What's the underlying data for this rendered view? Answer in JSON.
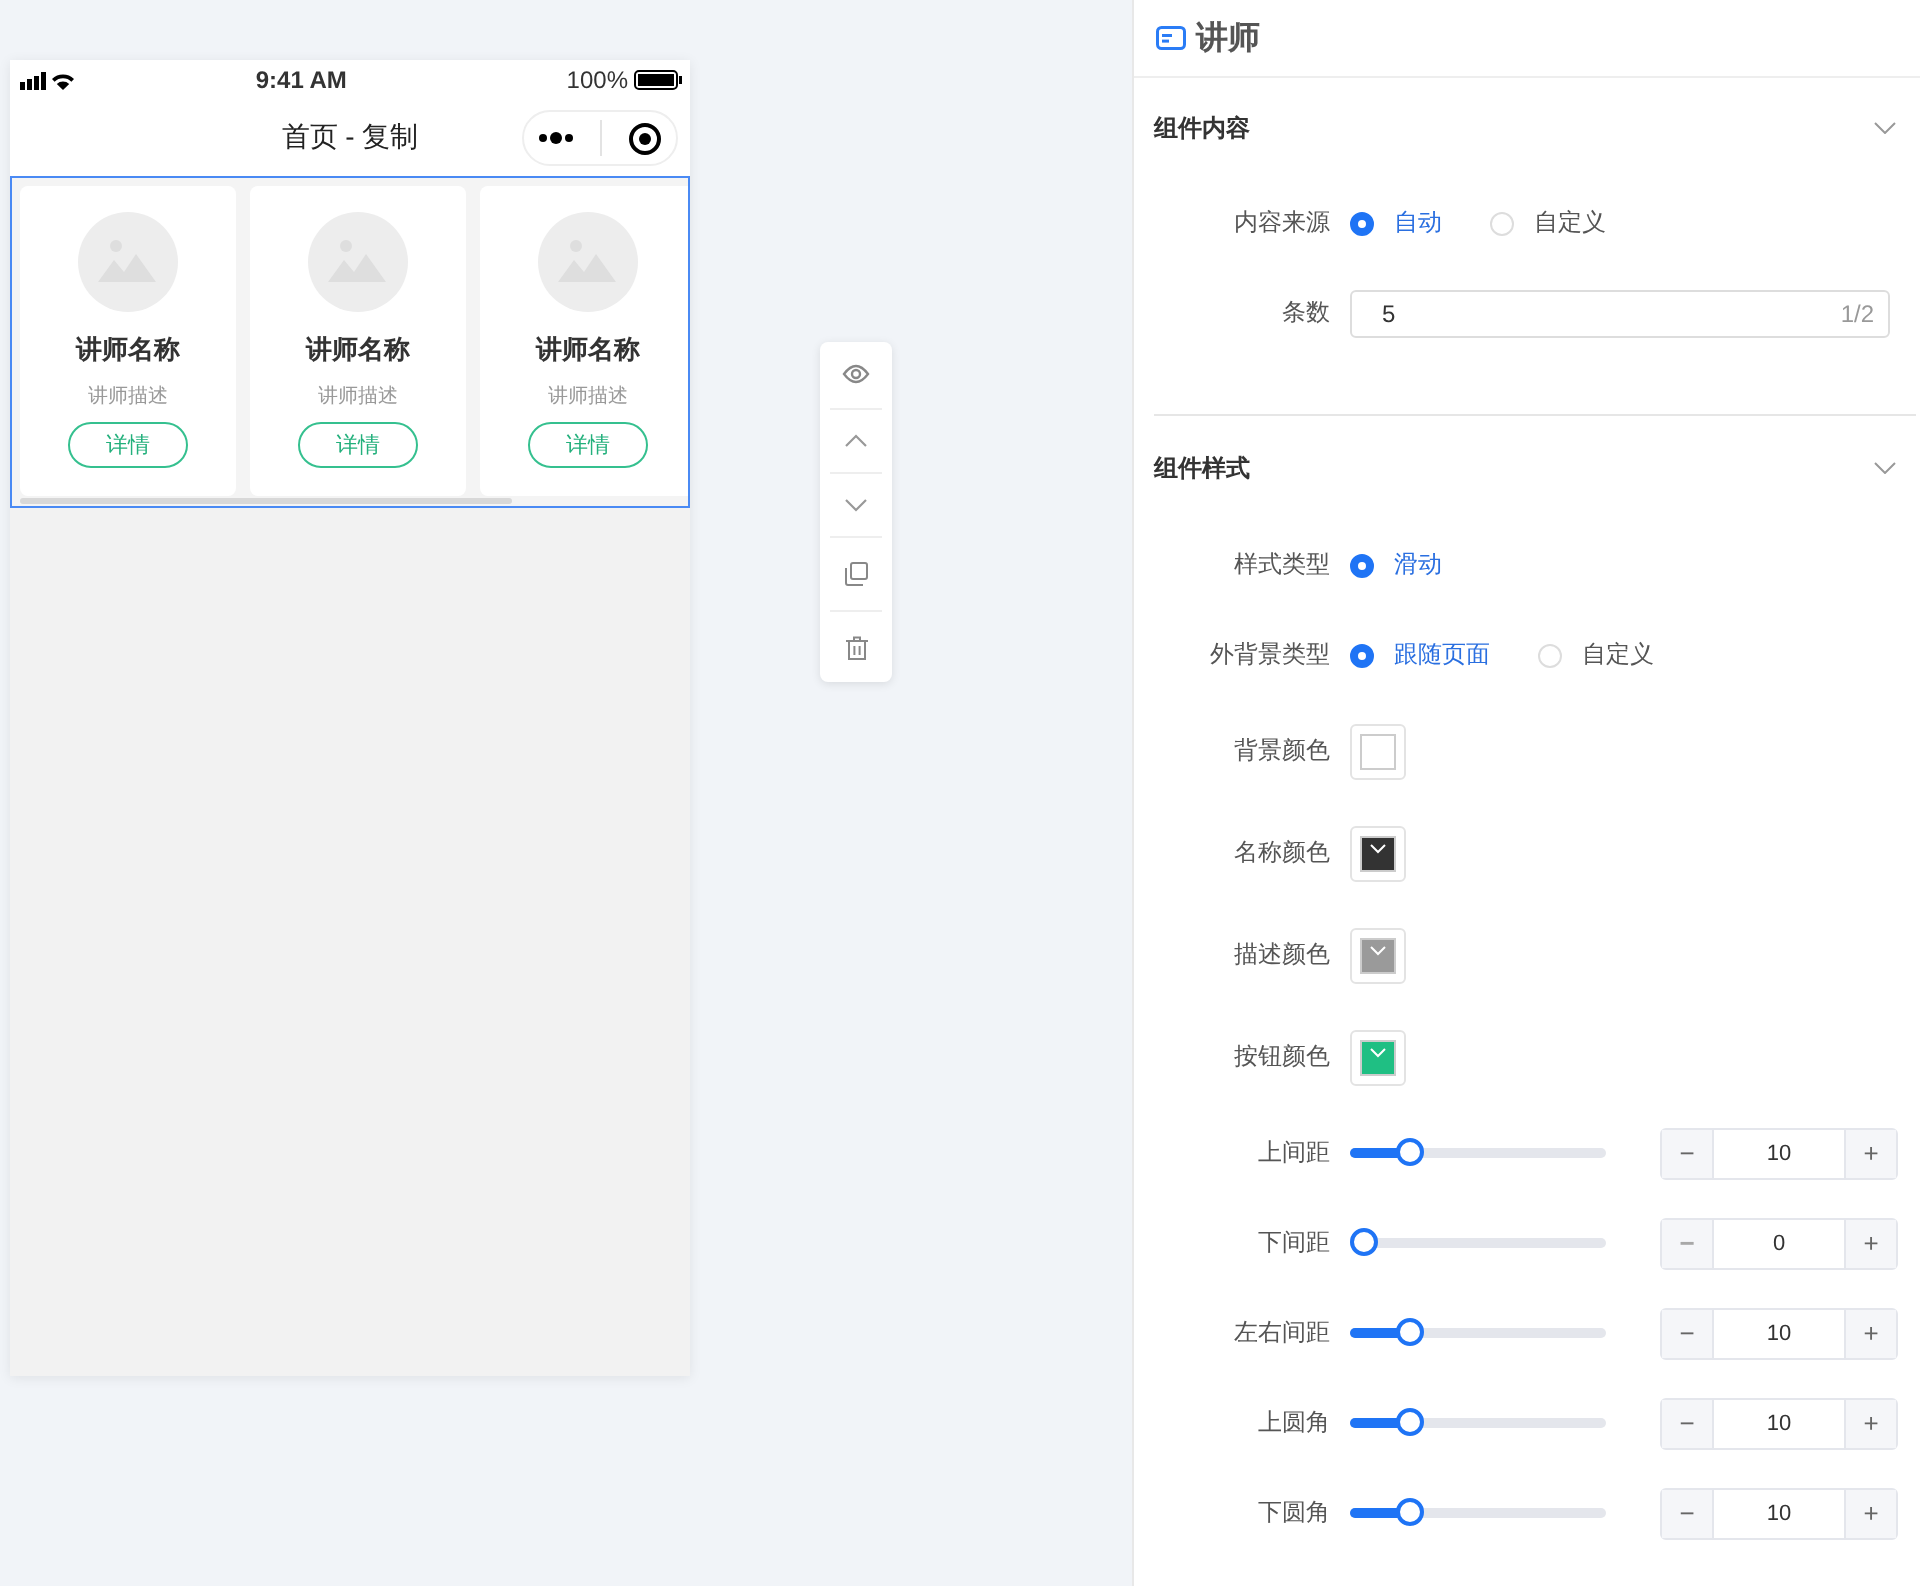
{
  "phone": {
    "time": "9:41 AM",
    "battery": "100%",
    "title": "首页 - 复制",
    "cards": [
      {
        "name": "讲师名称",
        "desc": "讲师描述",
        "button": "详情"
      },
      {
        "name": "讲师名称",
        "desc": "讲师描述",
        "button": "详情"
      },
      {
        "name": "讲师名称",
        "desc": "讲师描述",
        "button": "详情"
      }
    ]
  },
  "toolbar": [
    {
      "kind": "eye"
    },
    {
      "kind": "up"
    },
    {
      "kind": "down"
    },
    {
      "kind": "copy"
    },
    {
      "kind": "delete"
    }
  ],
  "panel": {
    "title": "讲师",
    "sections": [
      {
        "title": "组件内容",
        "fields": [
          {
            "kind": "radio",
            "label": "内容来源",
            "options": [
              {
                "label": "自动",
                "selected": true
              },
              {
                "label": "自定义",
                "selected": false
              }
            ]
          },
          {
            "kind": "input",
            "label": "条数",
            "value": "5",
            "counter": "1/2"
          }
        ]
      },
      {
        "title": "组件样式",
        "fields": [
          {
            "kind": "radio",
            "label": "样式类型",
            "options": [
              {
                "label": "滑动",
                "selected": true
              }
            ]
          },
          {
            "kind": "radio",
            "label": "外背景类型",
            "options": [
              {
                "label": "跟随页面",
                "selected": true
              },
              {
                "label": "自定义",
                "selected": false
              }
            ]
          },
          {
            "kind": "color",
            "label": "背景颜色",
            "color": "#ffffff"
          },
          {
            "kind": "color",
            "label": "名称颜色",
            "color": "#333333"
          },
          {
            "kind": "color",
            "label": "描述颜色",
            "color": "#9a9a9a"
          },
          {
            "kind": "color",
            "label": "按钮颜色",
            "color": "#1fbf83"
          },
          {
            "kind": "slider",
            "label": "上间距",
            "level": 0.2,
            "value": "10",
            "minus": "−",
            "plus": "+",
            "minus_disabled": false
          },
          {
            "kind": "slider",
            "label": "下间距",
            "level": 0,
            "value": "0",
            "minus": "−",
            "plus": "+",
            "minus_disabled": true
          },
          {
            "kind": "slider",
            "label": "左右间距",
            "level": 0.2,
            "value": "10",
            "minus": "−",
            "plus": "+",
            "minus_disabled": false
          },
          {
            "kind": "slider",
            "label": "上圆角",
            "level": 0.2,
            "value": "10",
            "minus": "−",
            "plus": "+",
            "minus_disabled": false
          },
          {
            "kind": "slider",
            "label": "下圆角",
            "level": 0.2,
            "value": "10",
            "minus": "−",
            "plus": "+",
            "minus_disabled": false
          }
        ]
      }
    ]
  }
}
